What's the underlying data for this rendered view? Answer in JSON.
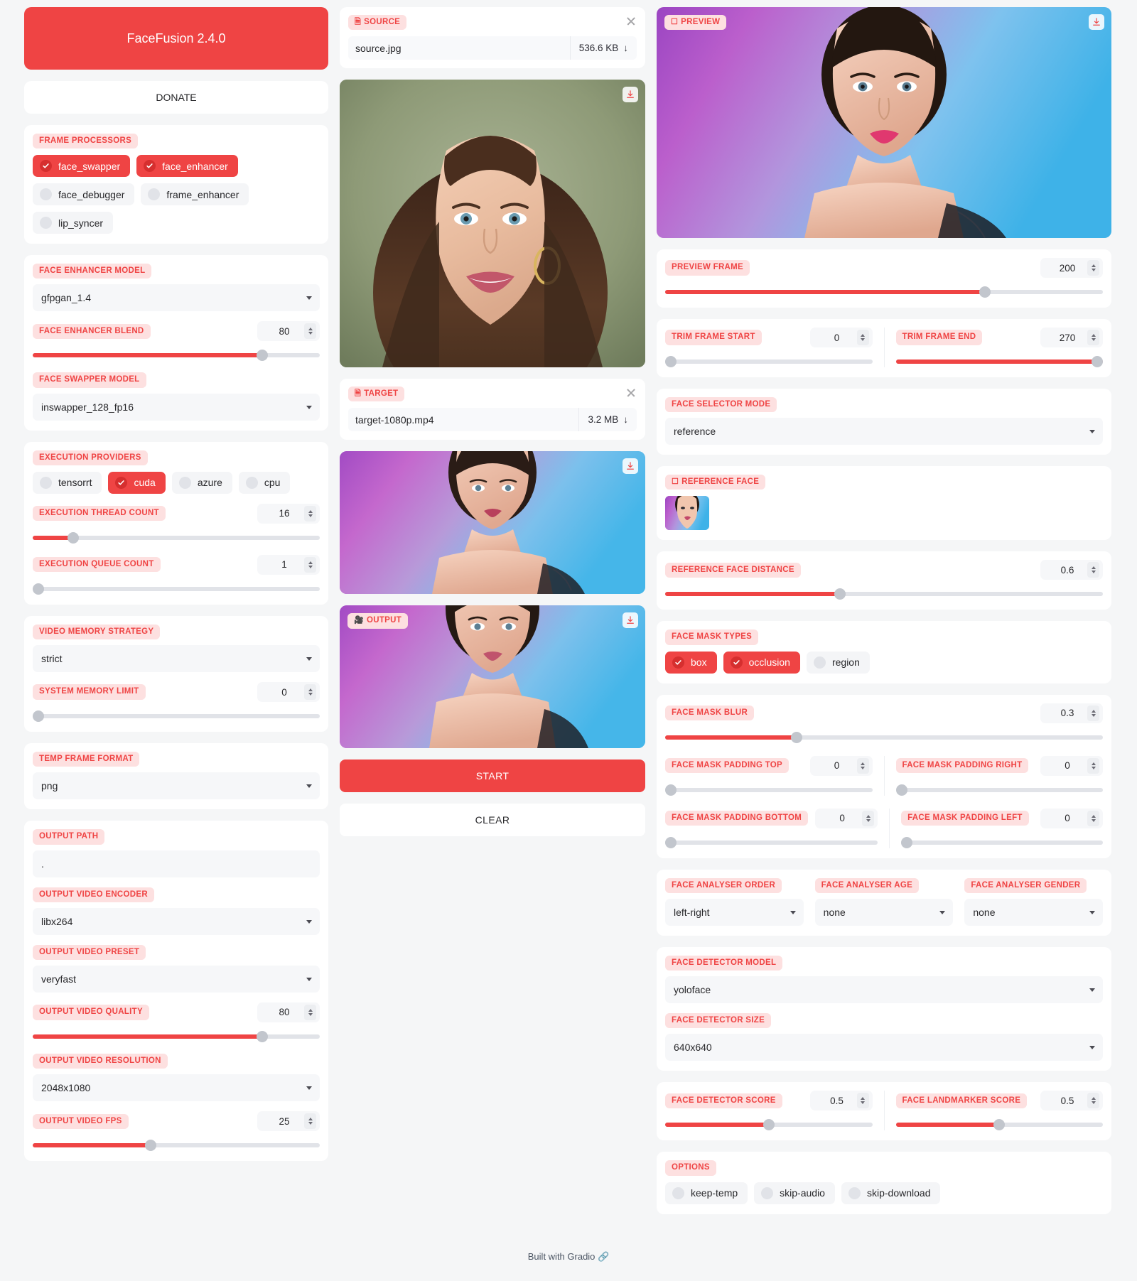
{
  "app": {
    "title": "FaceFusion 2.4.0",
    "donate_label": "DONATE",
    "footer_text": "Built with Gradio",
    "accent": "#ef4444",
    "label_bg": "#fde0e0"
  },
  "left": {
    "frame_processors": {
      "label": "FRAME PROCESSORS",
      "options": [
        {
          "name": "face_swapper",
          "checked": true
        },
        {
          "name": "face_enhancer",
          "checked": true
        },
        {
          "name": "face_debugger",
          "checked": false
        },
        {
          "name": "frame_enhancer",
          "checked": false
        },
        {
          "name": "lip_syncer",
          "checked": false
        }
      ]
    },
    "face_enhancer_model": {
      "label": "FACE ENHANCER MODEL",
      "value": "gfpgan_1.4"
    },
    "face_enhancer_blend": {
      "label": "FACE ENHANCER BLEND",
      "value": "80",
      "percent": 80
    },
    "face_swapper_model": {
      "label": "FACE SWAPPER MODEL",
      "value": "inswapper_128_fp16"
    },
    "execution_providers": {
      "label": "EXECUTION PROVIDERS",
      "options": [
        {
          "name": "tensorrt",
          "checked": false
        },
        {
          "name": "cuda",
          "checked": true
        },
        {
          "name": "azure",
          "checked": false
        },
        {
          "name": "cpu",
          "checked": false
        }
      ]
    },
    "execution_thread_count": {
      "label": "EXECUTION THREAD COUNT",
      "value": "16",
      "percent": 14
    },
    "execution_queue_count": {
      "label": "EXECUTION QUEUE COUNT",
      "value": "1",
      "percent": 0
    },
    "video_memory_strategy": {
      "label": "VIDEO MEMORY STRATEGY",
      "value": "strict"
    },
    "system_memory_limit": {
      "label": "SYSTEM MEMORY LIMIT",
      "value": "0",
      "percent": 0
    },
    "temp_frame_format": {
      "label": "TEMP FRAME FORMAT",
      "value": "png"
    },
    "output_path": {
      "label": "OUTPUT PATH",
      "value": "."
    },
    "output_video_encoder": {
      "label": "OUTPUT VIDEO ENCODER",
      "value": "libx264"
    },
    "output_video_preset": {
      "label": "OUTPUT VIDEO PRESET",
      "value": "veryfast"
    },
    "output_video_quality": {
      "label": "OUTPUT VIDEO QUALITY",
      "value": "80",
      "percent": 80
    },
    "output_video_resolution": {
      "label": "OUTPUT VIDEO RESOLUTION",
      "value": "2048x1080"
    },
    "output_video_fps": {
      "label": "OUTPUT VIDEO FPS",
      "value": "25",
      "percent": 41
    }
  },
  "mid": {
    "source": {
      "label": "SOURCE",
      "icon": "file-icon",
      "file_name": "source.jpg",
      "file_size": "536.6 KB"
    },
    "target": {
      "label": "TARGET",
      "icon": "file-icon",
      "file_name": "target-1080p.mp4",
      "file_size": "3.2 MB"
    },
    "output": {
      "label": "OUTPUT",
      "icon": "video-icon"
    },
    "start_label": "START",
    "clear_label": "CLEAR"
  },
  "right": {
    "preview": {
      "label": "PREVIEW",
      "icon": "image-icon"
    },
    "preview_frame": {
      "label": "PREVIEW FRAME",
      "value": "200",
      "percent": 73
    },
    "trim_frame_start": {
      "label": "TRIM FRAME START",
      "value": "0",
      "percent": 0
    },
    "trim_frame_end": {
      "label": "TRIM FRAME END",
      "value": "270",
      "percent": 100
    },
    "face_selector_mode": {
      "label": "FACE SELECTOR MODE",
      "value": "reference"
    },
    "reference_face": {
      "label": "REFERENCE FACE",
      "icon": "image-icon"
    },
    "reference_face_distance": {
      "label": "REFERENCE FACE DISTANCE",
      "value": "0.6",
      "percent": 40
    },
    "face_mask_types": {
      "label": "FACE MASK TYPES",
      "options": [
        {
          "name": "box",
          "checked": true
        },
        {
          "name": "occlusion",
          "checked": true
        },
        {
          "name": "region",
          "checked": false
        }
      ]
    },
    "face_mask_blur": {
      "label": "FACE MASK BLUR",
      "value": "0.3",
      "percent": 30
    },
    "face_mask_padding_top": {
      "label": "FACE MASK PADDING TOP",
      "value": "0",
      "percent": 0
    },
    "face_mask_padding_right": {
      "label": "FACE MASK PADDING RIGHT",
      "value": "0",
      "percent": 0
    },
    "face_mask_padding_bottom": {
      "label": "FACE MASK PADDING BOTTOM",
      "value": "0",
      "percent": 0
    },
    "face_mask_padding_left": {
      "label": "FACE MASK PADDING LEFT",
      "value": "0",
      "percent": 0
    },
    "face_analyser_order": {
      "label": "FACE ANALYSER ORDER",
      "value": "left-right"
    },
    "face_analyser_age": {
      "label": "FACE ANALYSER AGE",
      "value": "none"
    },
    "face_analyser_gender": {
      "label": "FACE ANALYSER GENDER",
      "value": "none"
    },
    "face_detector_model": {
      "label": "FACE DETECTOR MODEL",
      "value": "yoloface"
    },
    "face_detector_size": {
      "label": "FACE DETECTOR SIZE",
      "value": "640x640"
    },
    "face_detector_score": {
      "label": "FACE DETECTOR SCORE",
      "value": "0.5",
      "percent": 50
    },
    "face_landmarker_score": {
      "label": "FACE LANDMARKER SCORE",
      "value": "0.5",
      "percent": 50
    },
    "options": {
      "label": "OPTIONS",
      "items": [
        {
          "name": "keep-temp",
          "checked": false
        },
        {
          "name": "skip-audio",
          "checked": false
        },
        {
          "name": "skip-download",
          "checked": false
        }
      ]
    }
  }
}
